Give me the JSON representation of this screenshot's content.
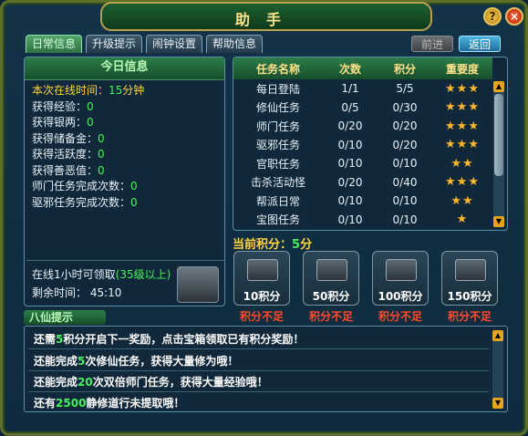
{
  "window": {
    "title": "助手"
  },
  "tabs": [
    "日常信息",
    "升级提示",
    "闹钟设置",
    "帮助信息"
  ],
  "nav": {
    "prev": "前进",
    "back": "返回"
  },
  "today": {
    "header": "今日信息",
    "online_label": "本次在线时间：",
    "online_value": "15",
    "online_unit": "分钟",
    "rows": [
      {
        "label": "获得经验：",
        "value": "0"
      },
      {
        "label": "获得银两：",
        "value": "0"
      },
      {
        "label": "获得储备金：",
        "value": "0"
      },
      {
        "label": "获得活跃度：",
        "value": "0"
      },
      {
        "label": "获得善恶值：",
        "value": "0"
      },
      {
        "label": "师门任务完成次数：",
        "value": "0"
      },
      {
        "label": "驱邪任务完成次数：",
        "value": "0"
      }
    ],
    "reward_line": "在线1小时可领取",
    "reward_cond": "(35级以上)",
    "remain_label": "剩余时间：",
    "remain_value": "45:10"
  },
  "tasks": {
    "headers": [
      "任务名称",
      "次数",
      "积分",
      "重要度"
    ],
    "rows": [
      {
        "name": "每日登陆",
        "count": "1/1",
        "score": "5/5",
        "stars": 3
      },
      {
        "name": "修仙任务",
        "count": "0/5",
        "score": "0/30",
        "stars": 3
      },
      {
        "name": "师门任务",
        "count": "0/20",
        "score": "0/20",
        "stars": 3
      },
      {
        "name": "驱邪任务",
        "count": "0/10",
        "score": "0/20",
        "stars": 3
      },
      {
        "name": "官职任务",
        "count": "0/10",
        "score": "0/10",
        "stars": 2
      },
      {
        "name": "击杀活动怪",
        "count": "0/20",
        "score": "0/40",
        "stars": 3
      },
      {
        "name": "帮派日常",
        "count": "0/10",
        "score": "0/10",
        "stars": 2
      },
      {
        "name": "宝图任务",
        "count": "0/10",
        "score": "0/10",
        "stars": 1
      }
    ]
  },
  "points": {
    "label": "当前积分：",
    "value": "5",
    "unit": "分"
  },
  "chests": [
    {
      "label": "10积分",
      "status": "积分不足"
    },
    {
      "label": "50积分",
      "status": "积分不足"
    },
    {
      "label": "100积分",
      "status": "积分不足"
    },
    {
      "label": "150积分",
      "status": "积分不足"
    }
  ],
  "tips": {
    "header": "八仙提示",
    "lines": [
      {
        "a": "还需",
        "n": "5",
        "b": "积分开启下一奖励，点击宝箱领取已有积分奖励！"
      },
      {
        "a": "还能完成",
        "n": "5",
        "b": "次修仙任务，获得大量修为哦！"
      },
      {
        "a": "还能完成",
        "n": "20",
        "b": "次双倍师门任务，获得大量经验哦！"
      },
      {
        "a": "还有",
        "n": "2500",
        "b": "静修道行未提取哦！"
      }
    ]
  }
}
